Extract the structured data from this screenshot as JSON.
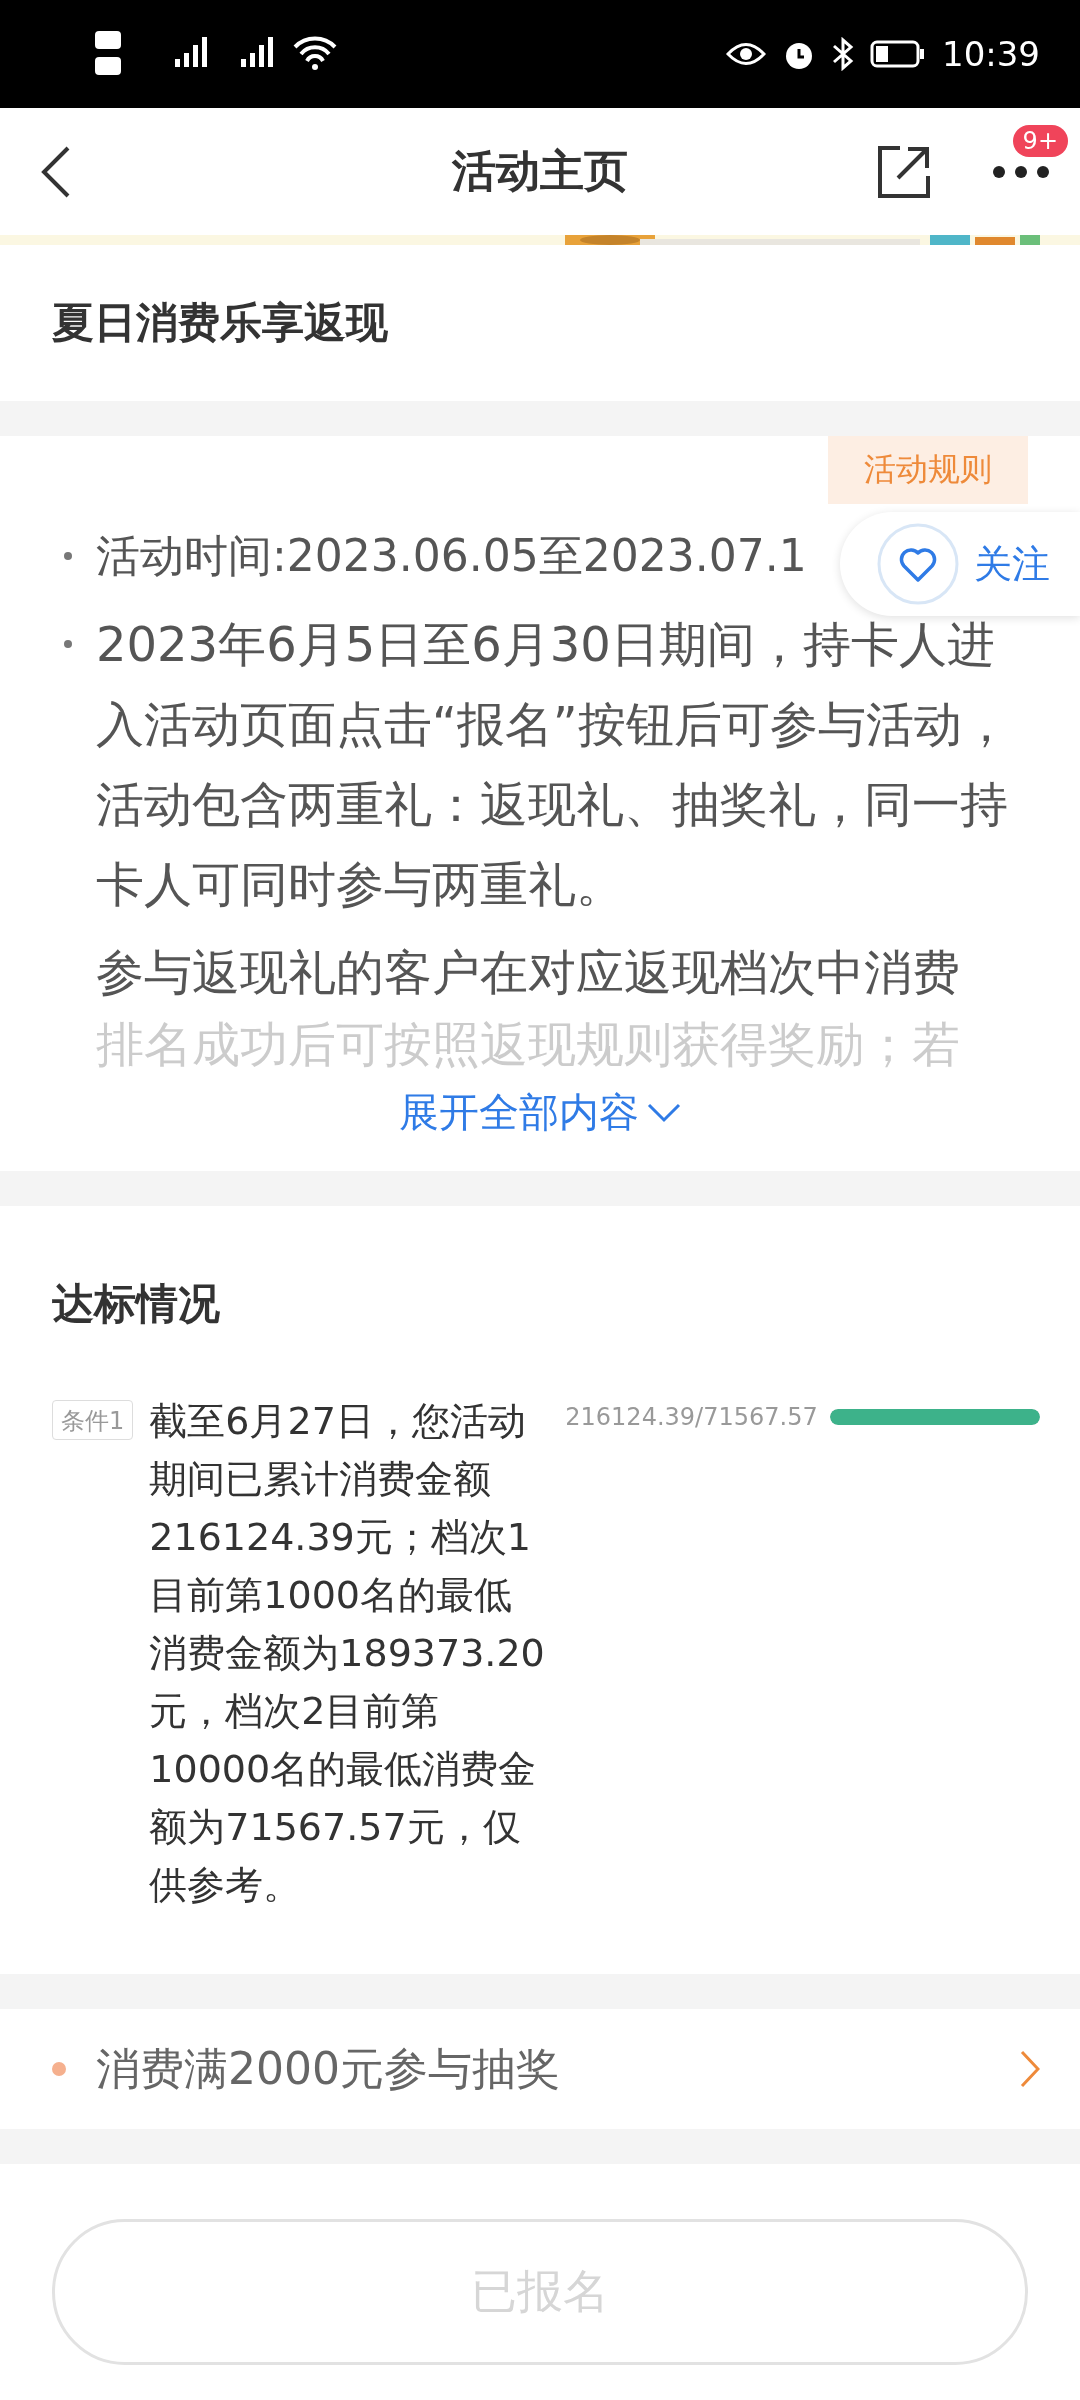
{
  "status_bar": {
    "time": "10:39"
  },
  "header": {
    "title": "活动主页",
    "badge": "9+"
  },
  "activity": {
    "title": "夏日消费乐享返现"
  },
  "rules": {
    "tab": "活动规则",
    "follow": "关注",
    "items": [
      "活动时间:2023.06.05至2023.07.1",
      "2023年6月5日至6月30日期间，持卡人进入活动页面点击“报名”按钮后可参与活动，活动包含两重礼：返现礼、抽奖礼，同一持卡人可同时参与两重礼。"
    ],
    "continuation": "参与返现礼的客户在对应返现档次中消费",
    "faded_line": "排名成功后可按照返现规则获得奖励；若",
    "expand": "展开全部内容"
  },
  "progress": {
    "title": "达标情况",
    "conditions": [
      {
        "tag": "条件1",
        "description": "截至6月27日，您活动期间已累计消费金额216124.39元；档次1目前第1000名的最低消费金额为189373.20元，档次2目前第10000名的最低消费金额为71567.57元，仅供参考。",
        "reading": "216124.39/71567.57",
        "level": 1
      }
    ]
  },
  "lottery": {
    "label": "消费满2000元参与抽奖"
  },
  "action": {
    "label": "已报名",
    "disabled": true
  }
}
